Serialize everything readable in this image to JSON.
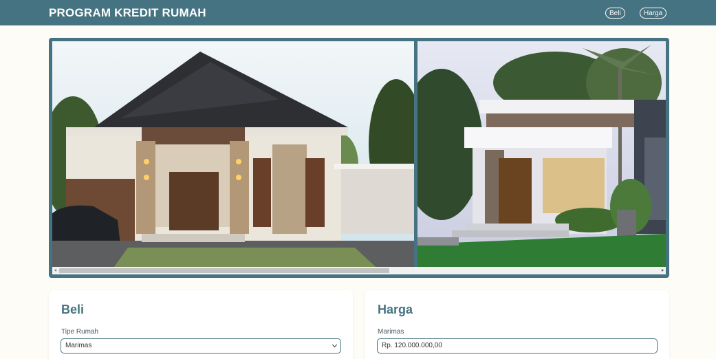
{
  "header": {
    "title": "PROGRAM KREDIT RUMAH",
    "nav": [
      {
        "label": "Beli"
      },
      {
        "label": "Harga"
      }
    ]
  },
  "gallery": {
    "images": [
      {
        "icon": "house-photo-icon"
      },
      {
        "icon": "house-photo-icon"
      }
    ]
  },
  "cards": {
    "beli": {
      "title": "Beli",
      "field_label": "Tipe Rumah",
      "selected": "Marimas"
    },
    "harga": {
      "title": "Harga",
      "field_label": "Marimas",
      "value": "Rp. 120.000.000,00"
    }
  },
  "colors": {
    "primary": "#467382",
    "background": "#fdfcf6",
    "card": "#ffffff"
  }
}
